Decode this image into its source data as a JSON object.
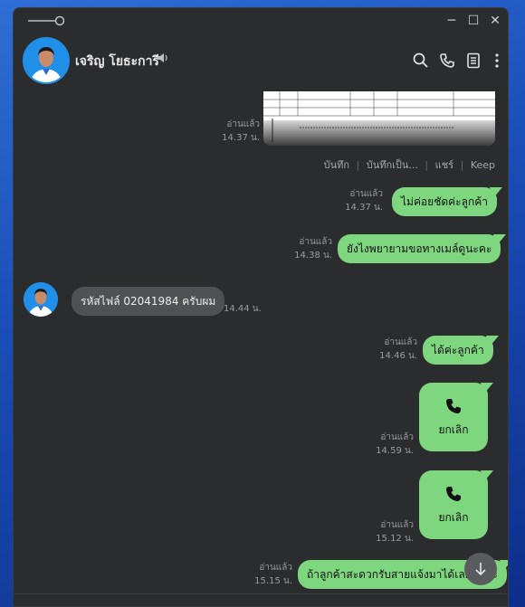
{
  "window": {
    "minimize": "─",
    "maximize": "☐",
    "close": "✕"
  },
  "header": {
    "contact_name": "เจริญ โยธะการี"
  },
  "image_message": {
    "read": "อ่านแล้ว",
    "time": "14.37 น.",
    "actions": [
      "บันทึก",
      "บันทึกเป็น...",
      "แชร์",
      "Keep"
    ]
  },
  "messages": [
    {
      "type": "out",
      "read": "อ่านแล้ว",
      "time": "14.37 น.",
      "text": "ไม่ค่อยชัดค่ะลูกค้า"
    },
    {
      "type": "out",
      "read": "อ่านแล้ว",
      "time": "14.38 น.",
      "text": "ยังไงพยายามขอทางเมล์ดูนะคะ"
    },
    {
      "type": "in",
      "time": "14.44 น.",
      "text": "รหัสไฟล์ 02041984 ครับผม"
    },
    {
      "type": "out",
      "read": "อ่านแล้ว",
      "time": "14.46 น.",
      "text": "ได้ค่ะลูกค้า"
    },
    {
      "type": "call",
      "read": "อ่านแล้ว",
      "time": "14.59 น.",
      "text": "ยกเลิก"
    },
    {
      "type": "call",
      "read": "อ่านแล้ว",
      "time": "15.12 น.",
      "text": "ยกเลิก"
    },
    {
      "type": "out",
      "read": "อ่านแล้ว",
      "time": "15.15 น.",
      "text": "ถ้าลูกค้าสะดวกรับสายแจ้งมาได้เลยนะคะ"
    }
  ],
  "colors": {
    "bubble_out": "#7ed67f",
    "bubble_in": "#505154",
    "window_bg": "#2b2c2e"
  }
}
